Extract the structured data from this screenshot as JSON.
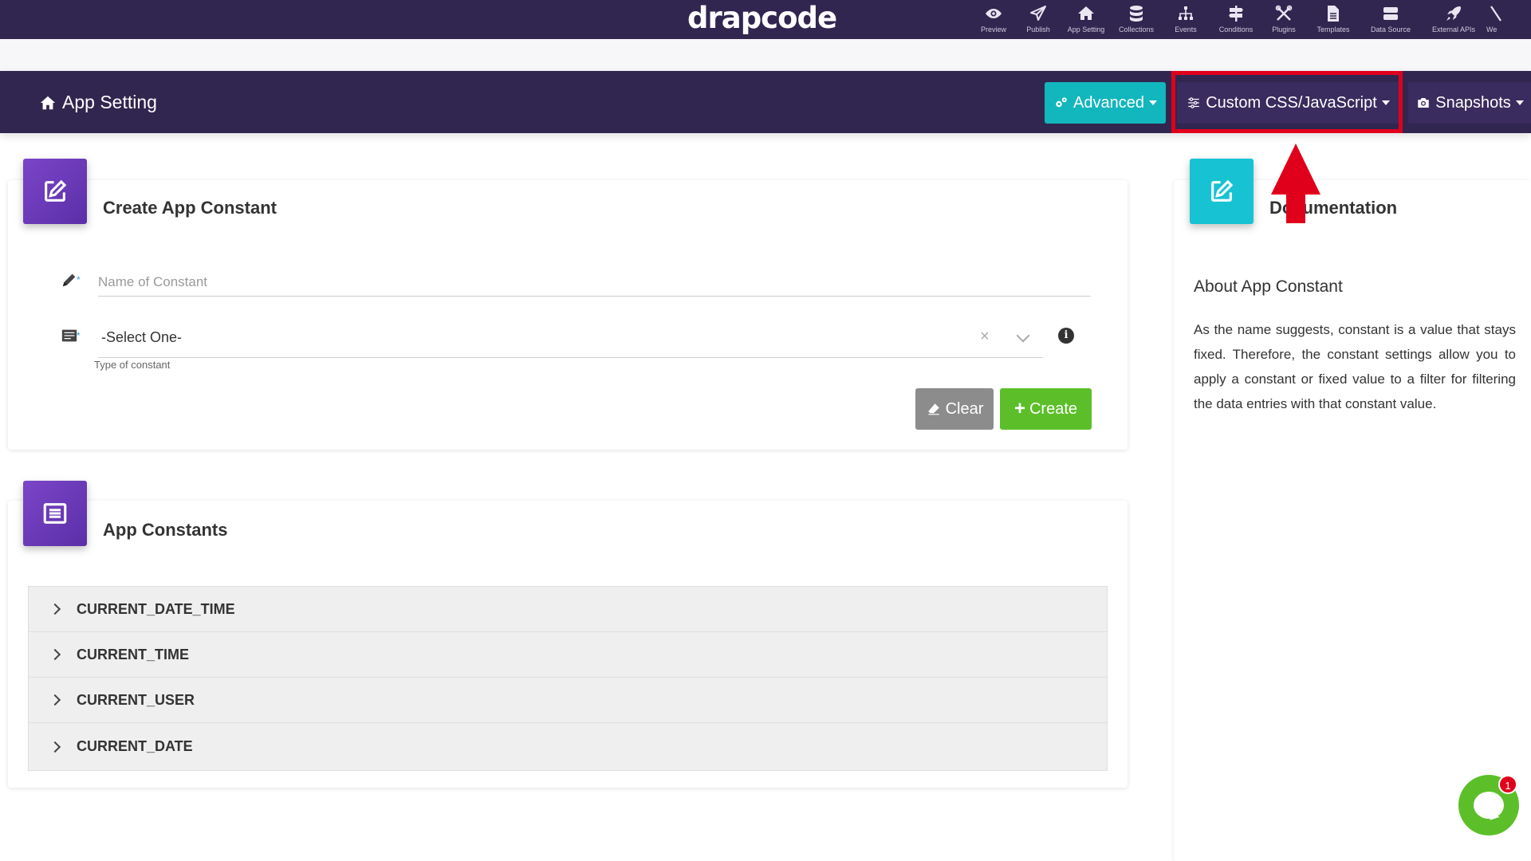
{
  "topbar": {
    "logo": "drapcode",
    "nav": [
      {
        "label": "Preview",
        "icon": "eye-icon"
      },
      {
        "label": "Publish",
        "icon": "paper-plane-icon"
      },
      {
        "label": "App Setting",
        "icon": "home-icon"
      },
      {
        "label": "Collections",
        "icon": "database-icon"
      },
      {
        "label": "Events",
        "icon": "sitemap-icon"
      },
      {
        "label": "Conditions",
        "icon": "signpost-icon"
      },
      {
        "label": "Plugins",
        "icon": "tools-icon"
      },
      {
        "label": "Templates",
        "icon": "file-icon"
      },
      {
        "label": "Data Source",
        "icon": "server-icon"
      },
      {
        "label": "External APIs",
        "icon": "rocket-icon"
      },
      {
        "label": "We",
        "icon": "web-icon"
      }
    ]
  },
  "appbar": {
    "title": "App Setting",
    "advanced_label": "Advanced",
    "custom_css_label": "Custom CSS/JavaScript",
    "snapshots_label": "Snapshots"
  },
  "annotation": {
    "highlight_color": "#e0001c",
    "arrow_color": "#e0001c"
  },
  "create_card": {
    "title": "Create App Constant",
    "name_placeholder": "Name of Constant",
    "name_value": "",
    "type_value": "-Select One-",
    "type_help": "Type of constant",
    "clear_label": "Clear",
    "create_label": "Create"
  },
  "list_card": {
    "title": "App Constants",
    "items": [
      "CURRENT_DATE_TIME",
      "CURRENT_TIME",
      "CURRENT_USER",
      "CURRENT_DATE"
    ]
  },
  "doc_card": {
    "title": "Documentation",
    "subtitle": "About App Constant",
    "body": "As the name suggests, constant is a value that stays fixed. Therefore, the constant settings allow you to apply a constant or fixed value to a filter for filtering the data entries with that constant value."
  },
  "chat": {
    "badge_count": "1"
  },
  "colors": {
    "nav_bg": "#31264f",
    "advanced_bg": "#12b6bd",
    "create_bg": "#5cbf2a",
    "clear_bg": "#8c8c8c",
    "purple_icon": "#6a3bb8",
    "teal_icon": "#17c3d2"
  }
}
